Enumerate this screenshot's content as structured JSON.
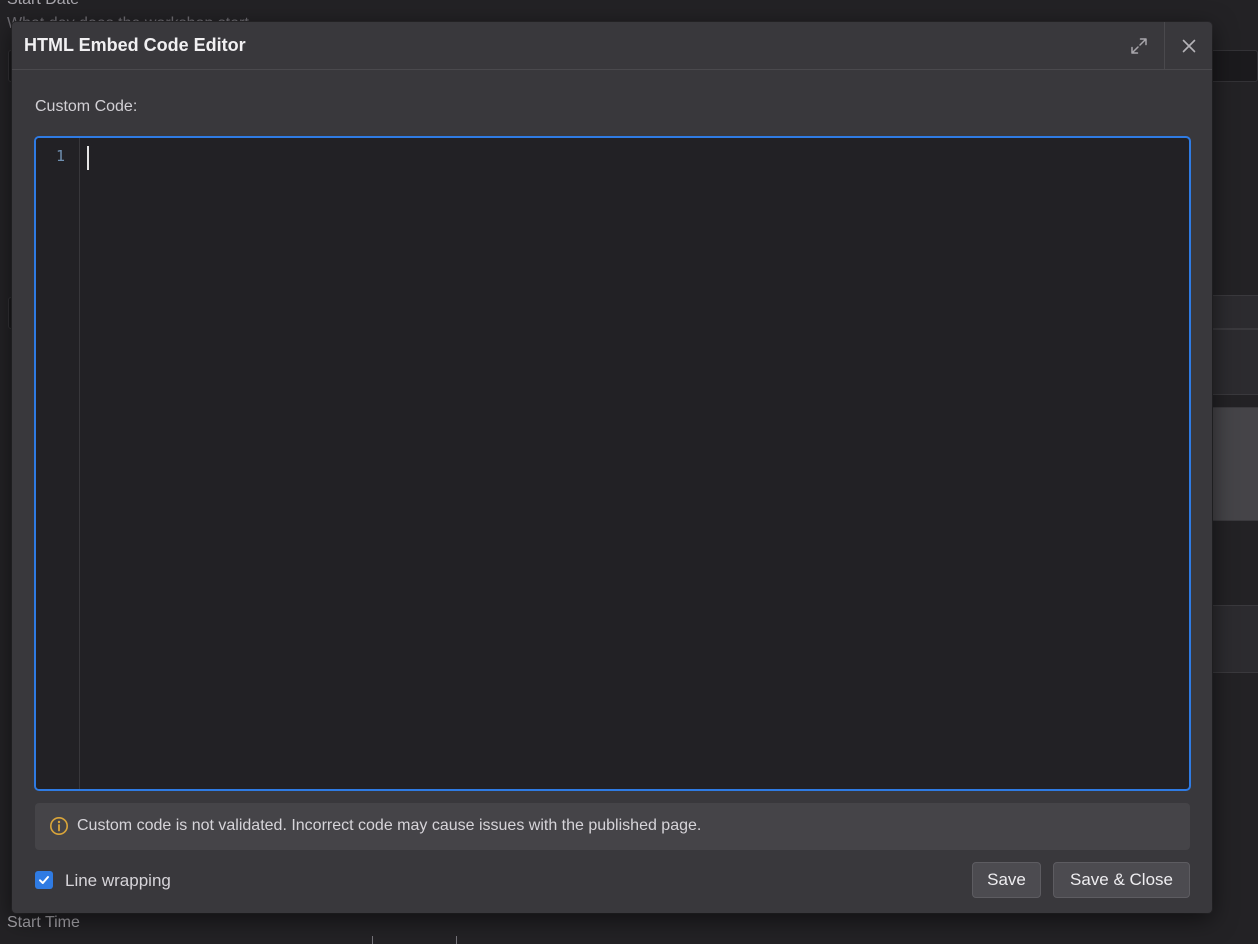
{
  "background_page": {
    "start_date_label": "Start Date",
    "start_date_hint": "What day does the workshop start",
    "start_time_label": "Start Time"
  },
  "modal": {
    "title": "HTML Embed Code Editor",
    "expand_icon": "expand-diagonal-icon",
    "close_icon": "close-icon",
    "custom_code_label": "Custom Code:",
    "editor": {
      "line_numbers": [
        "1"
      ],
      "content": "",
      "focused": true,
      "accent": "#2f7be3"
    },
    "warning": {
      "icon": "info-circle-icon",
      "icon_color": "#d9a53a",
      "text": "Custom code is not validated. Incorrect code may cause issues with the published page."
    },
    "line_wrapping": {
      "label": "Line wrapping",
      "checked": true
    },
    "buttons": {
      "save": "Save",
      "save_close": "Save & Close"
    }
  }
}
